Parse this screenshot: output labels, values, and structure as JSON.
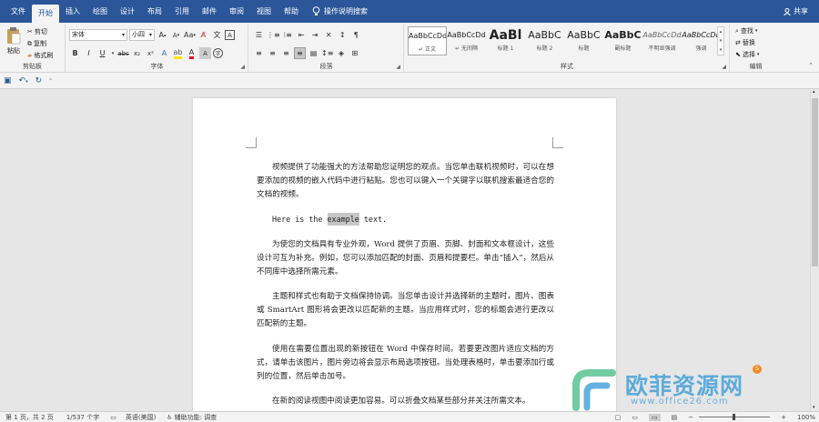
{
  "tabs": [
    {
      "label": "文件",
      "active": false
    },
    {
      "label": "开始",
      "active": true
    },
    {
      "label": "插入",
      "active": false
    },
    {
      "label": "绘图",
      "active": false
    },
    {
      "label": "设计",
      "active": false
    },
    {
      "label": "布局",
      "active": false
    },
    {
      "label": "引用",
      "active": false
    },
    {
      "label": "邮件",
      "active": false
    },
    {
      "label": "审阅",
      "active": false
    },
    {
      "label": "视图",
      "active": false
    },
    {
      "label": "帮助",
      "active": false
    }
  ],
  "tell_me": "操作说明搜索",
  "share": "共享",
  "clipboard": {
    "paste": "粘贴",
    "cut": "剪切",
    "copy": "复制",
    "format_painter": "格式刷",
    "label": "剪贴板"
  },
  "font": {
    "name": "宋体",
    "size": "小四",
    "label": "字体",
    "aa": "Aa"
  },
  "paragraph": {
    "label": "段落"
  },
  "styles": {
    "label": "样式",
    "items": [
      {
        "sample": "AaBbCcDd",
        "name": "↵ 正文",
        "selected": true
      },
      {
        "sample": "AaBbCcDd",
        "name": "↵ 无间隔",
        "selected": false
      },
      {
        "sample": "AaBl",
        "name": "标题 1",
        "selected": false
      },
      {
        "sample": "AaBbC",
        "name": "标题 2",
        "selected": false
      },
      {
        "sample": "AaBbC",
        "name": "标题",
        "selected": false
      },
      {
        "sample": "AaBbC",
        "name": "副标题",
        "selected": false
      },
      {
        "sample": "AaBbCcDd",
        "name": "不明显强调",
        "selected": false
      },
      {
        "sample": "AaBbCcDd",
        "name": "强调",
        "selected": false
      }
    ]
  },
  "editing": {
    "find": "查找",
    "replace": "替换",
    "select": "选择",
    "label": "编辑"
  },
  "document": {
    "p1": "视频提供了功能强大的方法帮助您证明您的观点。当您单击联机视频时，可以在想要添加的视频的嵌入代码中进行粘贴。您也可以键入一个关键字以联机搜索最适合您的文档的视频。",
    "p2_pre": "Here is the ",
    "p2_hl": "example",
    "p2_post": " text.",
    "p3": "为使您的文档具有专业外观，Word 提供了页眉、页脚、封面和文本框设计，这些设计可互为补充。例如，您可以添加匹配的封面、页眉和提要栏。单击“插入”，然后从不同库中选择所需元素。",
    "p4": "主题和样式也有助于文档保持协调。当您单击设计并选择新的主题时，图片、图表或 SmartArt 图形将会更改以匹配新的主题。当应用样式时，您的标题会进行更改以匹配新的主题。",
    "p5": "使用在需要位置出现的新按钮在 Word 中保存时间。若要更改图片适应文档的方式，请单击该图片，图片旁边将会显示布局选项按钮。当处理表格时，单击要添加行或列的位置，然后单击加号。",
    "p6": "在新的阅读视图中阅读更加容易。可以折叠文档某些部分并关注所需文本。"
  },
  "status": {
    "page": "第 1 页，共 2 页",
    "words": "1/537 个字",
    "language": "英语(美国)",
    "accessibility": "辅助功能: 调查",
    "zoom": "100%"
  },
  "watermark": {
    "title": "欧菲资源网",
    "url": "www.office26.com"
  },
  "colors": {
    "brand": "#2b579a",
    "watermark_green": "#4dbf8a",
    "watermark_blue": "#3f9fd8"
  }
}
